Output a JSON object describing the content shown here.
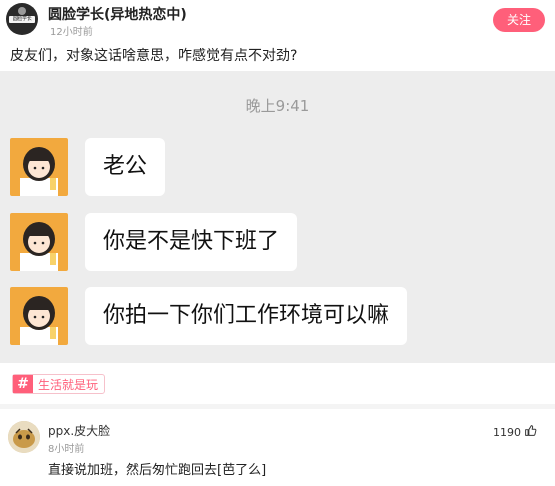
{
  "post": {
    "author_name": "圆脸学长(异地热恋中)",
    "time_ago": "12小时前",
    "follow_label": "关注",
    "text": "皮友们，对象这话啥意思，咋感觉有点不对劲?",
    "avatar_text": "圆脸学长"
  },
  "chat": {
    "time_label": "晚上9:41",
    "messages": [
      {
        "text": "老公"
      },
      {
        "text": "你是不是快下班了"
      },
      {
        "text": "你拍一下你们工作环境可以嘛"
      }
    ]
  },
  "tag": {
    "icon_glyph": "#",
    "label": "生活就是玩"
  },
  "comment": {
    "author_name": "ppx.皮大脸",
    "time_ago": "8小时前",
    "likes": "1190",
    "text": "直接说加班，然后匆忙跑回去[芭了么]"
  },
  "colors": {
    "accent": "#ff5f7a",
    "chat_background": "#ededed",
    "avatar_background": "#f2a93e"
  }
}
